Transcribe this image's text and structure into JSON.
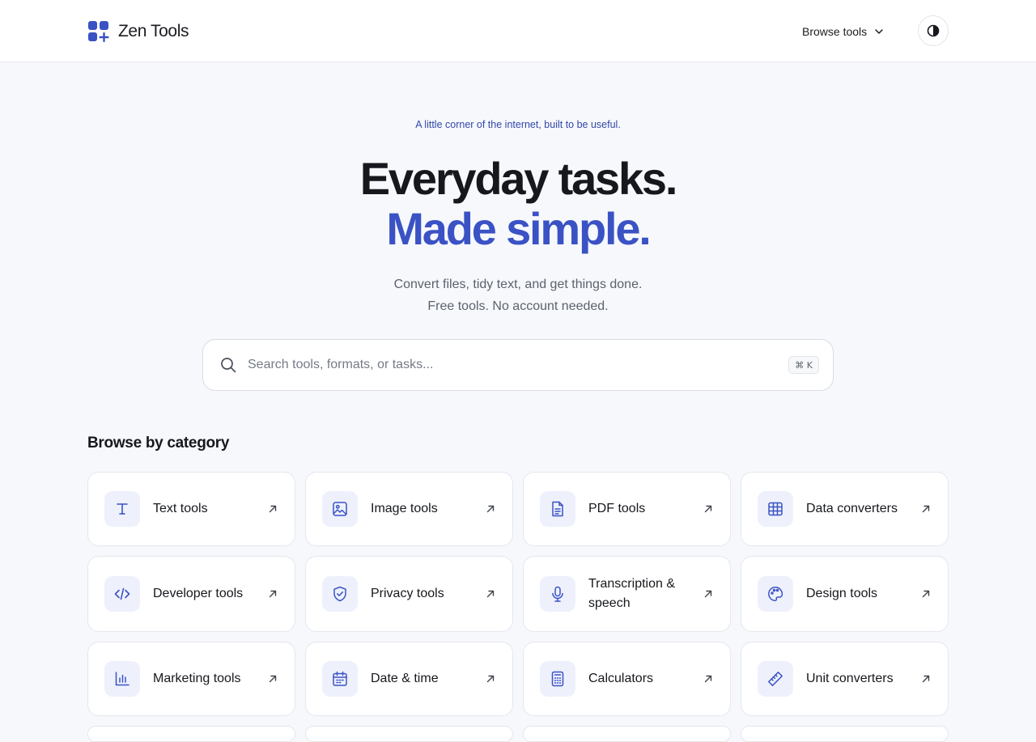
{
  "brand": {
    "name": "Zen Tools",
    "icon": "grid-plus-logo-icon",
    "accent": "#3a52c4"
  },
  "nav": {
    "browse_label": "Browse tools",
    "browse_icon": "chevron-down-icon",
    "theme_icon": "contrast-icon"
  },
  "hero": {
    "tagline": "A little corner of the internet, built to be useful.",
    "headline_line1": "Everyday tasks.",
    "headline_line2": "Made simple.",
    "sub_line1": "Convert files, tidy text, and get things done.",
    "sub_line2": "Free tools. No account needed."
  },
  "search": {
    "placeholder": "Search tools, formats, or tasks...",
    "shortcut": "⌘ K",
    "icon": "search-icon"
  },
  "categories": {
    "title": "Browse by category",
    "items": [
      {
        "label": "Text tools",
        "icon": "text-icon"
      },
      {
        "label": "Image tools",
        "icon": "image-icon"
      },
      {
        "label": "PDF tools",
        "icon": "document-icon"
      },
      {
        "label": "Data converters",
        "icon": "table-icon"
      },
      {
        "label": "Developer tools",
        "icon": "code-icon"
      },
      {
        "label": "Privacy tools",
        "icon": "shield-check-icon"
      },
      {
        "label": "Transcription & speech",
        "icon": "microphone-icon"
      },
      {
        "label": "Design tools",
        "icon": "palette-icon"
      },
      {
        "label": "Marketing tools",
        "icon": "bar-chart-icon"
      },
      {
        "label": "Date & time",
        "icon": "calendar-icon"
      },
      {
        "label": "Calculators",
        "icon": "calculator-icon"
      },
      {
        "label": "Unit converters",
        "icon": "ruler-icon"
      }
    ]
  }
}
